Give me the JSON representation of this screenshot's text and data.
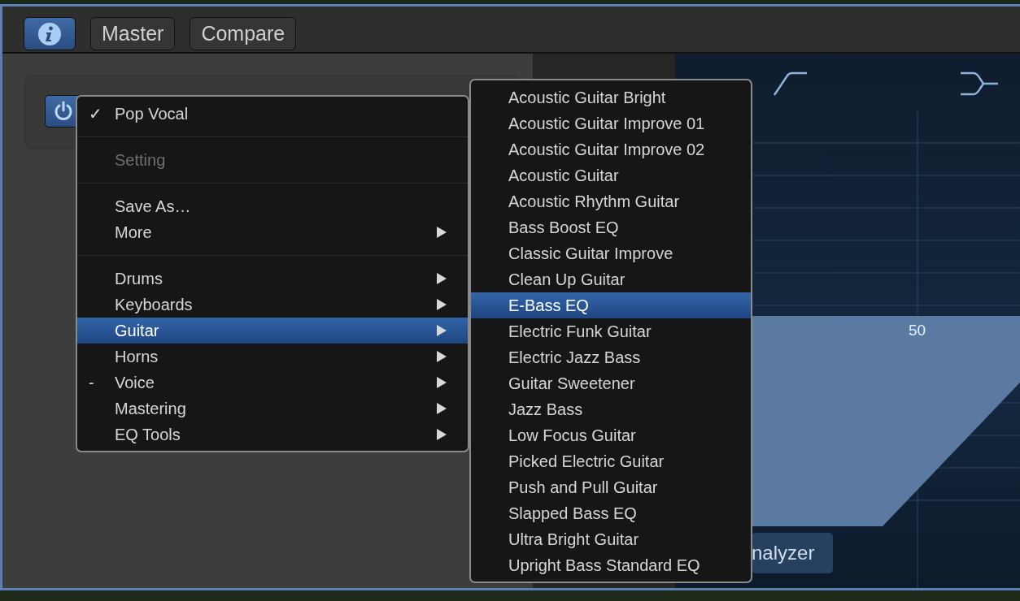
{
  "toolbar": {
    "info_active": true,
    "buttons": [
      "Master",
      "Compare"
    ]
  },
  "power_on": true,
  "menu": {
    "groups": [
      [
        {
          "label": "Pop Vocal",
          "mark": "✓",
          "disabled": false,
          "submenu": false,
          "selected": false
        }
      ],
      [
        {
          "label": "Setting",
          "disabled": true,
          "submenu": false,
          "selected": false
        }
      ],
      [
        {
          "label": "Save As…",
          "disabled": false,
          "submenu": false,
          "selected": false
        },
        {
          "label": "More",
          "disabled": false,
          "submenu": true,
          "selected": false
        }
      ],
      [
        {
          "label": "Drums",
          "disabled": false,
          "submenu": true,
          "selected": false
        },
        {
          "label": "Keyboards",
          "disabled": false,
          "submenu": true,
          "selected": false
        },
        {
          "label": "Guitar",
          "disabled": false,
          "submenu": true,
          "selected": true
        },
        {
          "label": "Horns",
          "disabled": false,
          "submenu": true,
          "selected": false
        },
        {
          "label": "Voice",
          "mark": "-",
          "disabled": false,
          "submenu": true,
          "selected": false
        },
        {
          "label": "Mastering",
          "disabled": false,
          "submenu": true,
          "selected": false
        },
        {
          "label": "EQ Tools",
          "disabled": false,
          "submenu": true,
          "selected": false
        }
      ]
    ]
  },
  "submenu": {
    "items": [
      {
        "label": "Acoustic Guitar Bright",
        "selected": false
      },
      {
        "label": "Acoustic Guitar Improve 01",
        "selected": false
      },
      {
        "label": "Acoustic Guitar Improve 02",
        "selected": false
      },
      {
        "label": "Acoustic Guitar",
        "selected": false
      },
      {
        "label": "Acoustic Rhythm Guitar",
        "selected": false
      },
      {
        "label": "Bass Boost EQ",
        "selected": false
      },
      {
        "label": "Classic Guitar Improve",
        "selected": false
      },
      {
        "label": "Clean Up Guitar",
        "selected": false
      },
      {
        "label": "E-Bass EQ",
        "selected": true
      },
      {
        "label": "Electric Funk Guitar",
        "selected": false
      },
      {
        "label": "Electric Jazz Bass",
        "selected": false
      },
      {
        "label": "Guitar Sweetener",
        "selected": false
      },
      {
        "label": "Jazz Bass",
        "selected": false
      },
      {
        "label": "Low Focus Guitar",
        "selected": false
      },
      {
        "label": "Picked Electric Guitar",
        "selected": false
      },
      {
        "label": "Push and Pull Guitar",
        "selected": false
      },
      {
        "label": "Slapped Bass EQ",
        "selected": false
      },
      {
        "label": "Ultra Bright Guitar",
        "selected": false
      },
      {
        "label": "Upright Bass Standard EQ",
        "selected": false
      }
    ]
  },
  "eq": {
    "frequency_label": "50",
    "analyzer_label": "nalyzer"
  }
}
